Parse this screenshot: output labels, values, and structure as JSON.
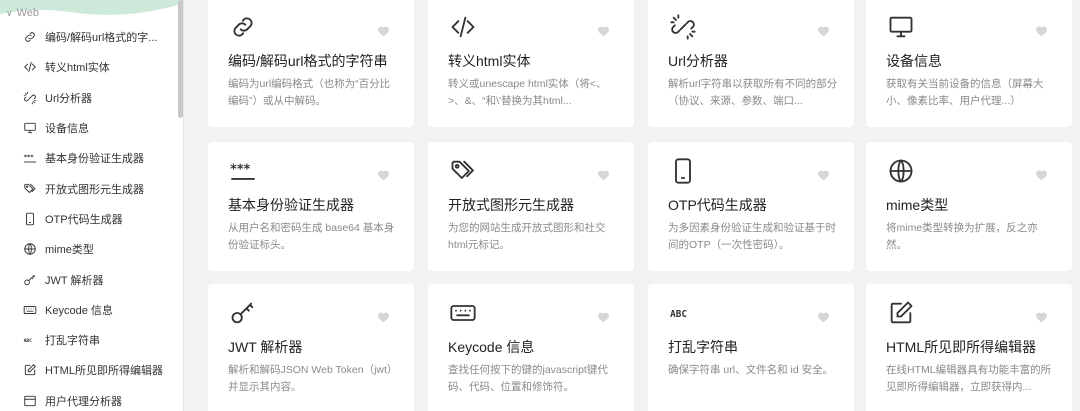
{
  "sidebar": {
    "section_label": "Web",
    "items": [
      {
        "label": "编码/解码url格式的字...",
        "icon": "link-icon"
      },
      {
        "label": "转义html实体",
        "icon": "code-icon"
      },
      {
        "label": "Url分析器",
        "icon": "broken-link-icon"
      },
      {
        "label": "设备信息",
        "icon": "monitor-icon"
      },
      {
        "label": "基本身份验证生成器",
        "icon": "password-icon"
      },
      {
        "label": "开放式图形元生成器",
        "icon": "tags-icon"
      },
      {
        "label": "OTP代码生成器",
        "icon": "phone-icon"
      },
      {
        "label": "mime类型",
        "icon": "globe-icon"
      },
      {
        "label": "JWT 解析器",
        "icon": "key-icon"
      },
      {
        "label": "Keycode 信息",
        "icon": "keyboard-icon"
      },
      {
        "label": "打乱字符串",
        "icon": "abc-icon"
      },
      {
        "label": "HTML所见即所得编辑器",
        "icon": "edit-icon"
      },
      {
        "label": "用户代理分析器",
        "icon": "browser-icon"
      }
    ]
  },
  "cards": [
    {
      "title": "编码/解码url格式的字符串",
      "desc": "编码为url编码格式（也称为“百分比编码”）或从中解码。",
      "icon": "link-icon"
    },
    {
      "title": "转义html实体",
      "desc": "转义或unescape html实体（将<、>、&、“和\\'替换为其html...",
      "icon": "code-icon"
    },
    {
      "title": "Url分析器",
      "desc": "解析url字符串以获取所有不同的部分（协议、来源、参数、端口...",
      "icon": "broken-link-icon"
    },
    {
      "title": "设备信息",
      "desc": "获取有关当前设备的信息（屏幕大小、像素比率、用户代理...）",
      "icon": "monitor-icon"
    },
    {
      "title": "基本身份验证生成器",
      "desc": "从用户名和密码生成 base64 基本身份验证标头。",
      "icon": "password-icon"
    },
    {
      "title": "开放式图形元生成器",
      "desc": "为您的网站生成开放式图形和社交html元标记。",
      "icon": "tags-icon"
    },
    {
      "title": "OTP代码生成器",
      "desc": "为多因素身份验证生成和验证基于时间的OTP（一次性密码）。",
      "icon": "phone-icon"
    },
    {
      "title": "mime类型",
      "desc": "将mime类型转换为扩展，反之亦然。",
      "icon": "globe-icon"
    },
    {
      "title": "JWT 解析器",
      "desc": "解析和解码JSON Web Token（jwt）并显示其内容。",
      "icon": "key-icon"
    },
    {
      "title": "Keycode 信息",
      "desc": "查找任何按下的键的javascript键代码、代码、位置和修饰符。",
      "icon": "keyboard-icon"
    },
    {
      "title": "打乱字符串",
      "desc": "确保字符串 url、文件名和 id 安全。",
      "icon": "abc-icon"
    },
    {
      "title": "HTML所见即所得编辑器",
      "desc": "在线HTML编辑器具有功能丰富的所见即所得编辑器，立即获得内...",
      "icon": "edit-icon"
    }
  ],
  "colors": {
    "background": "#f1f2f3",
    "card": "#ffffff",
    "icon": "#333333",
    "heart": "#d6d6d6",
    "wave": "#bfe3cf"
  }
}
